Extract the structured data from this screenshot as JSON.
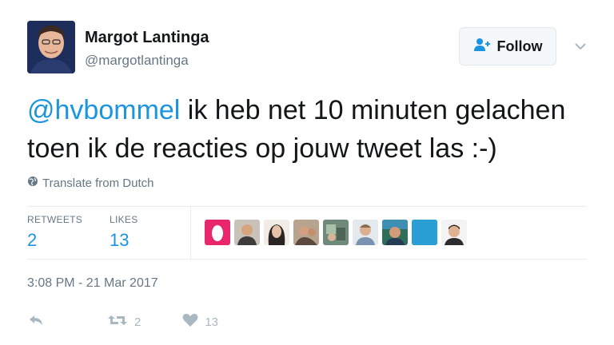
{
  "user": {
    "name": "Margot Lantinga",
    "handle": "@margotlantinga"
  },
  "follow_button": {
    "label": "Follow"
  },
  "tweet": {
    "mention": "@hvbommel",
    "text": " ik heb net 10 minuten gelachen toen ik de reacties op jouw tweet las :-)"
  },
  "translate": {
    "label": "Translate from Dutch"
  },
  "stats": {
    "retweets_label": "RETWEETS",
    "retweets_count": "2",
    "likes_label": "LIKES",
    "likes_count": "13"
  },
  "timestamp": "3:08 PM - 21 Mar 2017",
  "actions": {
    "reply_icon": "reply-icon",
    "retweet_icon": "retweet-icon",
    "retweet_count": "2",
    "like_icon": "heart-icon",
    "like_count": "13"
  },
  "colors": {
    "link": "#1b95e0",
    "muted": "#657786",
    "action_gray": "#aab8c2"
  }
}
